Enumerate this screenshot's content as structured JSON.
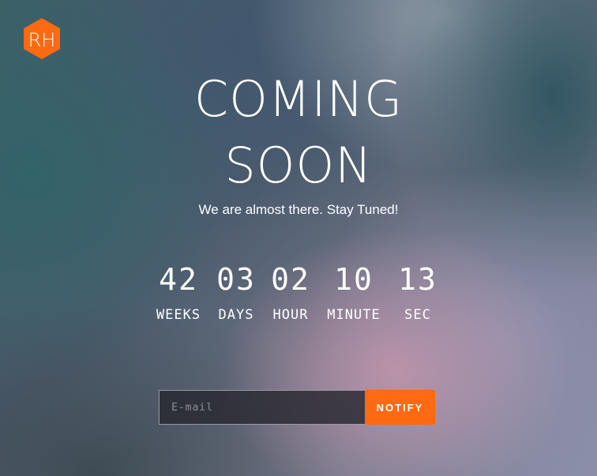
{
  "brand": {
    "logo_text": "RH",
    "logo_icon": "hexagon-logo-icon",
    "accent_color": "#ff6a13"
  },
  "hero": {
    "line1": "COMING",
    "line2": "SOON",
    "tagline": "We are almost there. Stay Tuned!"
  },
  "countdown": [
    {
      "value": "42",
      "label": "WEEKS"
    },
    {
      "value": "03",
      "label": "DAYS"
    },
    {
      "value": "02",
      "label": "HOUR"
    },
    {
      "value": "10",
      "label": "MINUTE"
    },
    {
      "value": "13",
      "label": "SEC"
    }
  ],
  "subscribe": {
    "email_placeholder": "E-mail",
    "email_value": "",
    "button_label": "NOTIFY"
  }
}
